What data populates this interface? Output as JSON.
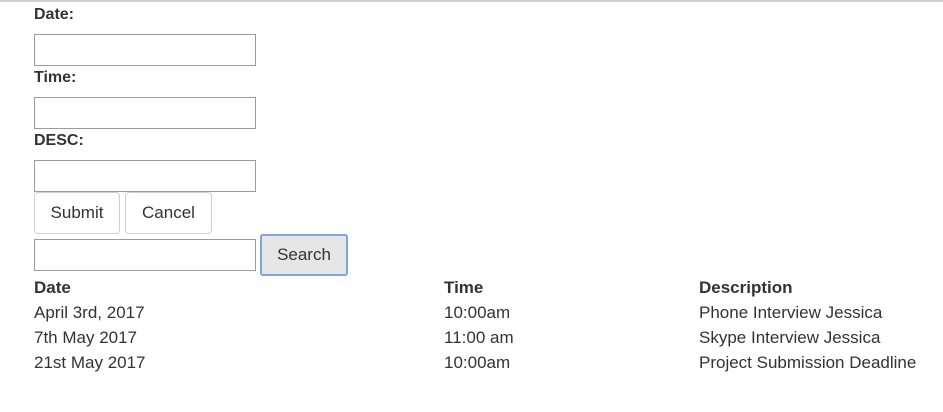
{
  "form": {
    "date_label": "Date:",
    "date_value": "",
    "time_label": "Time:",
    "time_value": "",
    "desc_label": "DESC:",
    "desc_value": "",
    "submit_label": "Submit",
    "cancel_label": "Cancel"
  },
  "search": {
    "value": "",
    "button_label": "Search"
  },
  "table": {
    "headers": {
      "date": "Date",
      "time": "Time",
      "description": "Description"
    },
    "rows": [
      {
        "date": "April 3rd, 2017",
        "time": "10:00am",
        "description": "Phone Interview Jessica"
      },
      {
        "date": "7th May 2017",
        "time": "11:00 am",
        "description": "Skype Interview Jessica"
      },
      {
        "date": "21st May 2017",
        "time": "10:00am",
        "description": "Project Submission Deadline"
      }
    ]
  }
}
